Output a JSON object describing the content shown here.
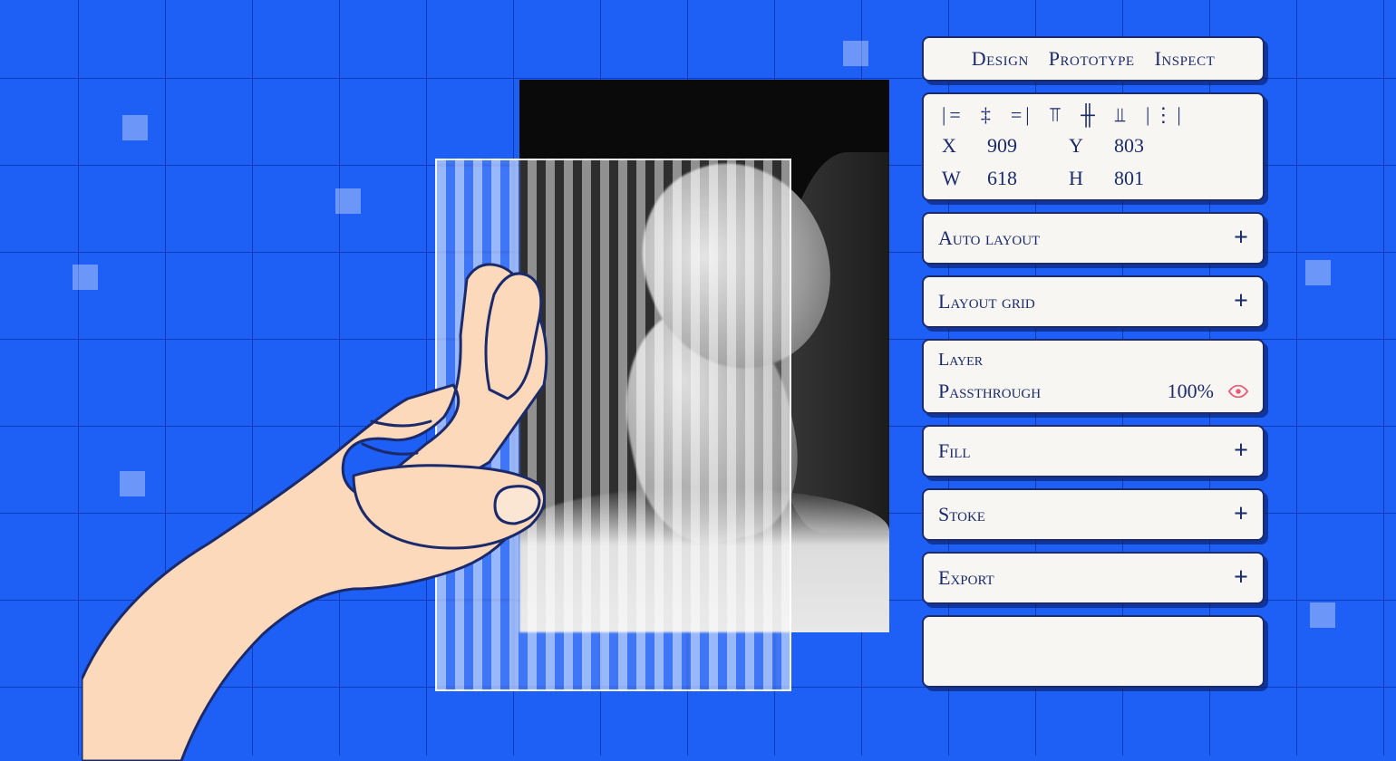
{
  "tabs": {
    "design": "Design",
    "prototype": "Prototype",
    "inspect": "Inspect"
  },
  "align_icons": {
    "left": "|=",
    "center_h": "‡",
    "right": "=|",
    "top": "⫪",
    "center_v": "╫",
    "bottom": "⫫",
    "distribute": "|⋮|"
  },
  "position": {
    "x_label": "X",
    "x_value": "909",
    "y_label": "Y",
    "y_value": "803",
    "w_label": "W",
    "w_value": "618",
    "h_label": "H",
    "h_value": "801"
  },
  "sections": {
    "auto_layout": "Auto layout",
    "layout_grid": "Layout grid",
    "fill": "Fill",
    "stroke": "Stoke",
    "export": "Export"
  },
  "layer": {
    "title": "Layer",
    "blend_mode": "Passthrough",
    "opacity": "100%"
  },
  "plus": "+"
}
